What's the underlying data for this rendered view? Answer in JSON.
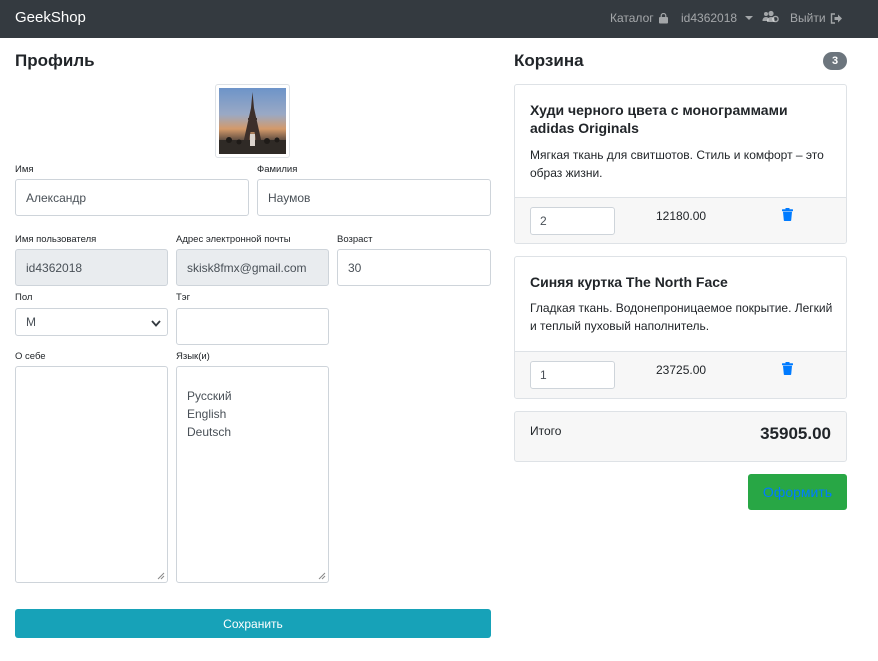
{
  "navbar": {
    "brand": "GeekShop",
    "catalog_label": "Каталог",
    "user_label": "id4362018",
    "logout_label": "Выйти",
    "bg_color": "#343a40"
  },
  "profile": {
    "title": "Профиль",
    "avatar_icon": "eiffel-tower-photo",
    "first_name_label": "Имя",
    "first_name_value": "Александр",
    "last_name_label": "Фамилия",
    "last_name_value": "Наумов",
    "username_label": "Имя пользователя",
    "username_value": "id4362018",
    "email_label": "Адрес электронной почты",
    "email_value": "skisk8fmx@gmail.com",
    "age_label": "Возраст",
    "age_value": "30",
    "gender_label": "Пол",
    "gender_value": "M",
    "tag_label": "Тэг",
    "tag_value": "",
    "about_label": "О себе",
    "about_value": "",
    "languages_label": "Язык(и)",
    "languages": [
      "Русский",
      "English",
      "Deutsch"
    ],
    "save_label": "Сохранить"
  },
  "cart": {
    "title": "Корзина",
    "count": "3",
    "items": [
      {
        "name": "Худи черного цвета с монограммами adidas Originals",
        "description": "Мягкая ткань для свитшотов. Стиль и комфорт – это образ жизни.",
        "quantity": "2",
        "price": "12180.00"
      },
      {
        "name": "Синяя куртка The North Face",
        "description": "Гладкая ткань. Водонепроницаемое покрытие. Легкий и теплый пуховый наполнитель.",
        "quantity": "1",
        "price": "23725.00"
      }
    ],
    "total_label": "Итого",
    "total_value": "35905.00",
    "order_label": "Оформить"
  },
  "colors": {
    "save_button": "#17a2b8",
    "order_button": "#28a745",
    "trash_icon": "#007bff",
    "badge": "#6c757d"
  }
}
